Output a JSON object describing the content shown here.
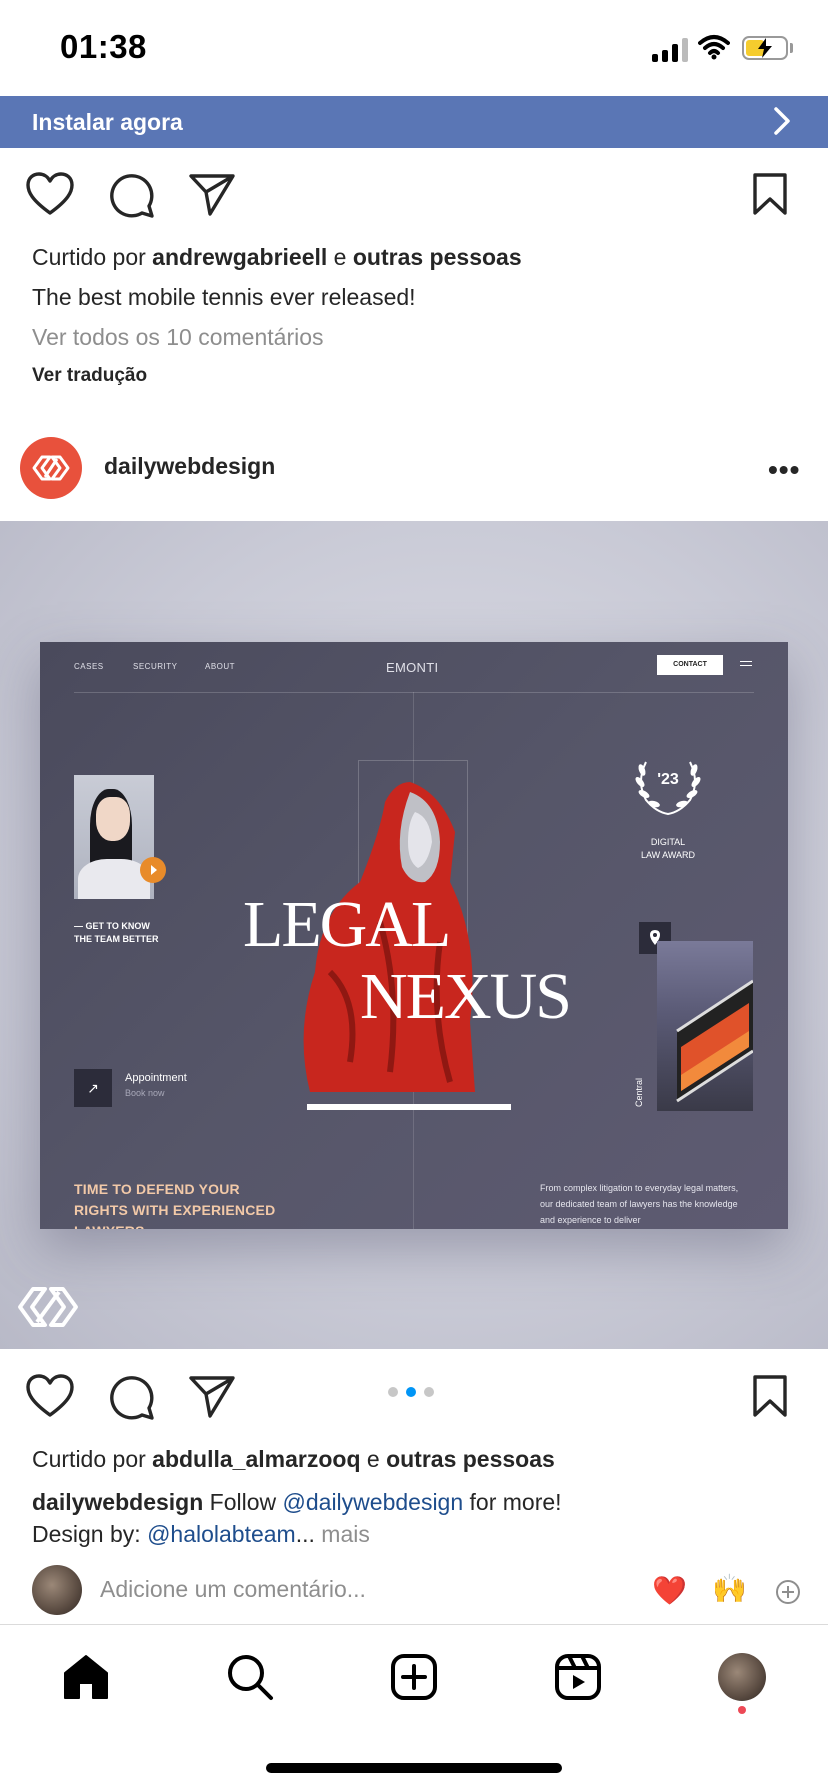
{
  "status_bar": {
    "time": "01:38"
  },
  "install_banner": {
    "label": "Instalar agora"
  },
  "post1": {
    "likes_prefix": "Curtido por ",
    "likes_user": "andrewgabrieell",
    "likes_mid": " e ",
    "likes_rest": "outras pessoas",
    "caption": "The best mobile tennis ever released!",
    "view_comments": "Ver todos os 10 comentários",
    "translate": "Ver tradução"
  },
  "post2": {
    "username": "dailywebdesign",
    "carousel": {
      "total": 3,
      "active": 2
    },
    "mockup": {
      "nav": [
        "CASES",
        "SECURITY",
        "ABOUT"
      ],
      "brand": "EMONTI",
      "contact": "CONTACT",
      "get_to_know": "— GET TO KNOW",
      "team_better": "THE TEAM BETTER",
      "title_1": "LEGAL",
      "title_2": "NEXUS",
      "award_year": "'23",
      "award_1": "DIGITAL",
      "award_2": "LAW AWARD",
      "appointment": "Appointment",
      "book_now": "Book now",
      "central": "Central",
      "headline_1": "TIME TO DEFEND YOUR",
      "headline_2": "RIGHTS WITH EXPERIENCED",
      "headline_3": "LAWYERS",
      "paragraph": "From complex litigation to everyday legal matters, our dedicated team of lawyers has the knowledge and experience to deliver"
    },
    "likes_prefix": "Curtido por ",
    "likes_user": "abdulla_almarzooq",
    "likes_mid": " e ",
    "likes_rest": "outras pessoas",
    "caption_user": "dailywebdesign",
    "caption_text_1": " Follow ",
    "caption_mention_1": "@dailywebdesign",
    "caption_text_2": " for more!",
    "caption_line2_prefix": "Design by: ",
    "caption_mention_2": "@halolabteam",
    "caption_ellipsis": "...",
    "more_label": " mais",
    "comment_placeholder": "Adicione um comentário...",
    "quick_emojis": [
      "❤️",
      "🙌"
    ]
  },
  "tabbar": {
    "items": [
      "home-icon",
      "search-icon",
      "create-icon",
      "reels-icon",
      "profile-avatar"
    ],
    "active": "home-icon"
  },
  "colors": {
    "banner": "#5a76b5",
    "link": "#1e4d8c",
    "accent": "#0095f6",
    "notification": "#ed4956",
    "brand_avatar": "#e8513c"
  }
}
